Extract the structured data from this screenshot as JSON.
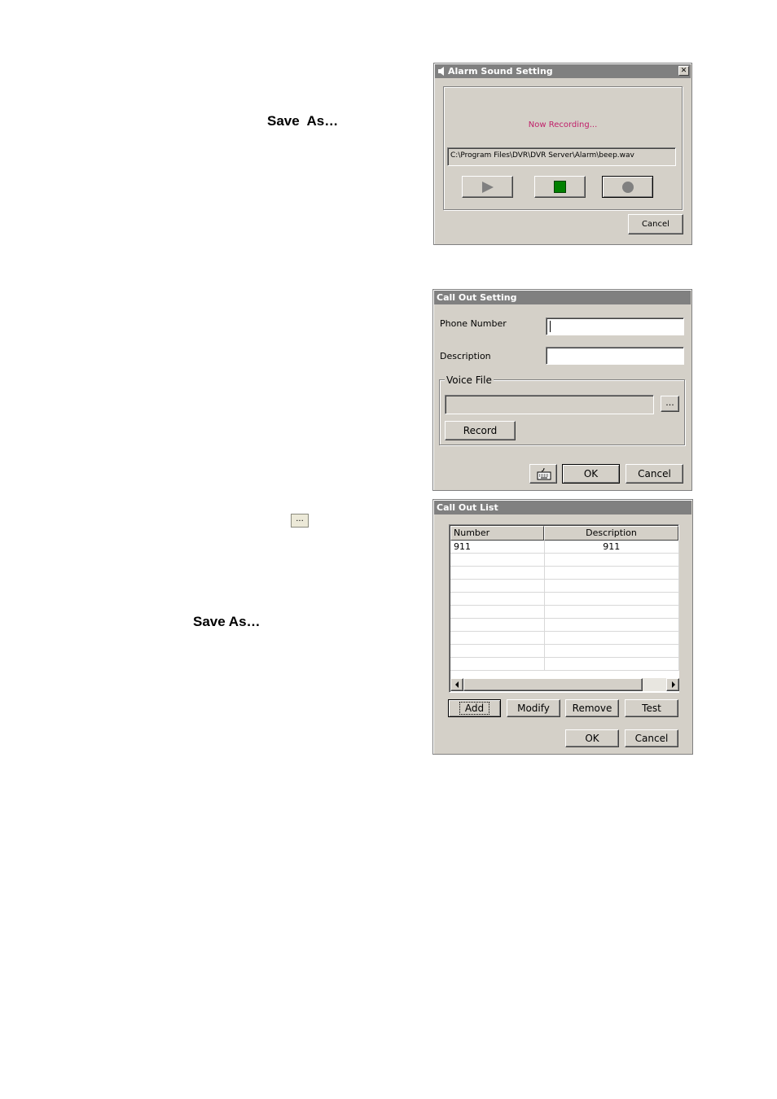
{
  "doc": {
    "save_as_1": "Save  As…",
    "save_as_2": "Save As…",
    "browse_inline": "..."
  },
  "alarm_dialog": {
    "title": "Alarm Sound Setting",
    "close": "✕",
    "status": "Now Recording...",
    "file_path": "C:\\Program Files\\DVR\\DVR Server\\Alarm\\beep.wav",
    "cancel": "Cancel",
    "play_icon": "play-icon",
    "stop_icon": "stop-icon",
    "record_icon": "record-icon",
    "colors": {
      "status": "#c0206a",
      "stop": "#008000",
      "record": "#808080"
    }
  },
  "callout_setting": {
    "title": "Call Out Setting",
    "phone_label": "Phone Number",
    "phone_value": "",
    "description_label": "Description",
    "description_value": "",
    "voice_group": "Voice File",
    "voice_value": "",
    "browse": "...",
    "record": "Record",
    "ok": "OK",
    "cancel": "Cancel",
    "keyboard_icon": "keyboard-icon"
  },
  "callout_list": {
    "title": "Call Out List",
    "columns": [
      "Number",
      "Description"
    ],
    "rows": [
      [
        "911",
        "911"
      ],
      [
        "",
        ""
      ],
      [
        "",
        ""
      ],
      [
        "",
        ""
      ],
      [
        "",
        ""
      ],
      [
        "",
        ""
      ],
      [
        "",
        ""
      ],
      [
        "",
        ""
      ],
      [
        "",
        ""
      ],
      [
        "",
        ""
      ]
    ],
    "add": "Add",
    "modify": "Modify",
    "remove": "Remove",
    "test": "Test",
    "ok": "OK",
    "cancel": "Cancel"
  }
}
